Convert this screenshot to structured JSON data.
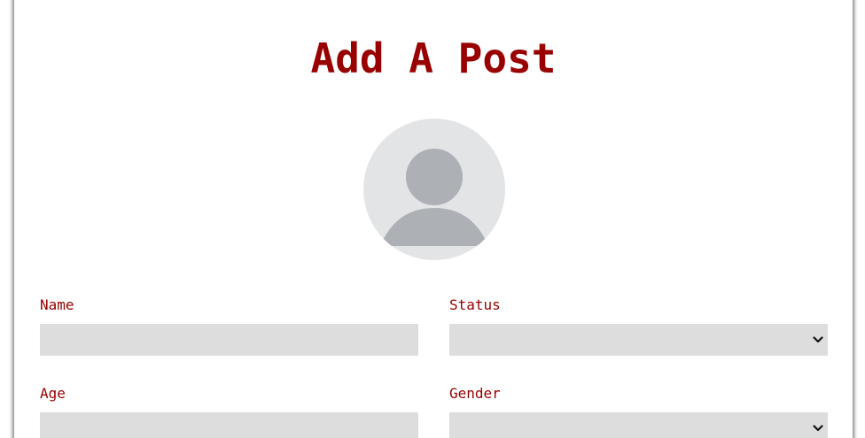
{
  "page": {
    "title": "Add A Post"
  },
  "form": {
    "name": {
      "label": "Name",
      "value": "",
      "placeholder": ""
    },
    "status": {
      "label": "Status",
      "selected": ""
    },
    "age": {
      "label": "Age",
      "value": "",
      "placeholder": ""
    },
    "gender": {
      "label": "Gender",
      "selected": ""
    }
  },
  "colors": {
    "accent": "#990000",
    "input_background": "#dddddd",
    "avatar_background": "#e2e4e6",
    "avatar_figure": "#adb1b5"
  },
  "icons": {
    "avatar": "user-avatar-icon",
    "select_arrow": "chevron-down-icon"
  }
}
